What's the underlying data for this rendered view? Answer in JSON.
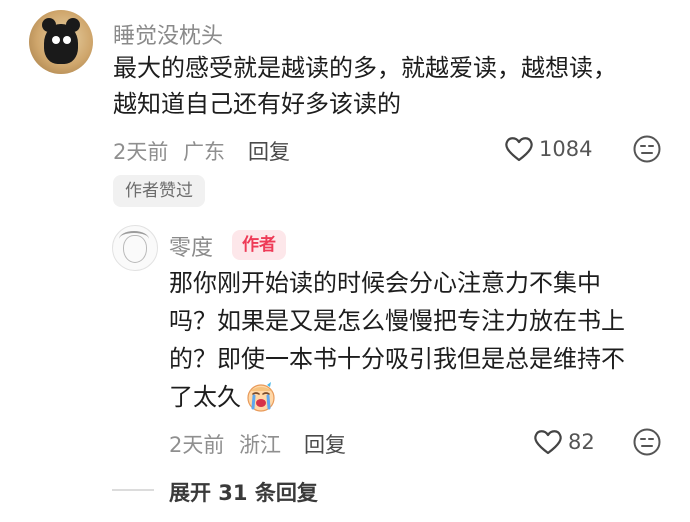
{
  "comment": {
    "username": "睡觉没枕头",
    "text_line1": "最大的感受就是越读的多，就越爱读，越想读，",
    "text_line2": "越知道自己还有好多该读的",
    "time": "2天前",
    "location": "广东",
    "reply_label": "回复",
    "like_count": "1084",
    "author_liked_label": "作者赞过"
  },
  "reply": {
    "username": "零度",
    "author_badge": "作者",
    "text_line1": "那你刚开始读的时候会分心注意力不集中",
    "text_line2": "吗？如果是又是怎么慢慢把专注力放在书上",
    "text_line3": "的？即使一本书十分吸引我但是总是维持不",
    "text_line4": "了太久",
    "time": "2天前",
    "location": "浙江",
    "reply_label": "回复",
    "like_count": "82"
  },
  "expand_replies_label": "展开 31 条回复",
  "icons": {
    "like": "heart-outline-icon",
    "dislike": "neutral-face-icon",
    "emoji": "crying-emoji-icon"
  },
  "colors": {
    "author_badge_text": "#ee3b57",
    "author_badge_bg": "#fde7ea"
  }
}
